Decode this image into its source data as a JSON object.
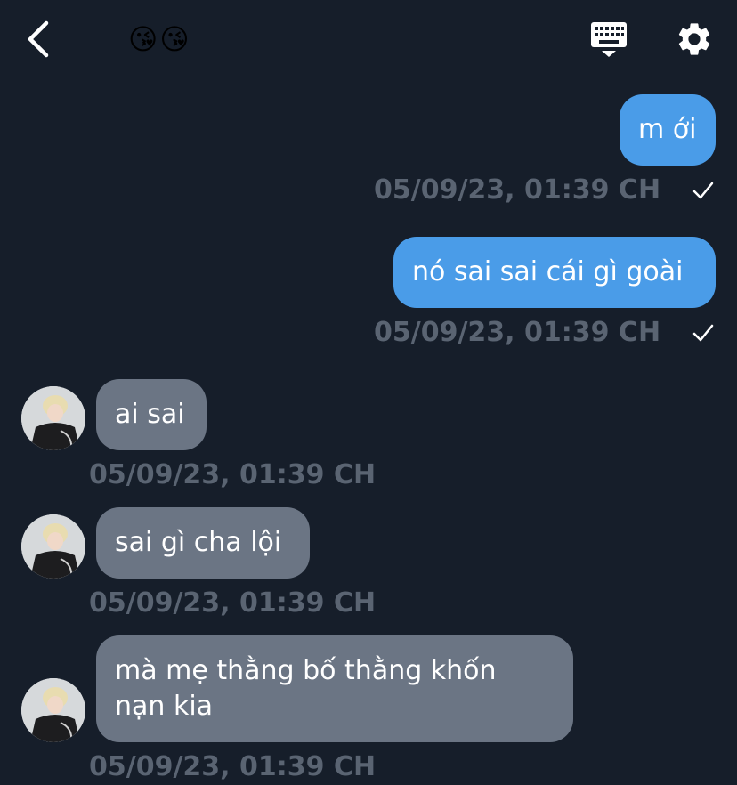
{
  "header": {
    "title": "😘😘"
  },
  "messages": [
    {
      "text": "m ới",
      "time": "05/09/23, 01:39 CH",
      "direction": "outgoing"
    },
    {
      "text": "nó sai sai cái gì goài",
      "time": "05/09/23, 01:39 CH",
      "direction": "outgoing"
    },
    {
      "text": "ai sai",
      "time": "05/09/23, 01:39 CH",
      "direction": "incoming"
    },
    {
      "text": "sai gì cha lội",
      "time": "05/09/23, 01:39 CH",
      "direction": "incoming"
    },
    {
      "text": "mà mẹ thằng bố thằng khốn\nnạn kia",
      "time": "05/09/23, 01:39 CH",
      "direction": "incoming"
    }
  ],
  "colors": {
    "background": "#161e2a",
    "outgoing_bubble": "#4a9ce8",
    "incoming_bubble": "#6b7584",
    "timestamp": "#5a6472"
  },
  "icons": {
    "back": "chevron-left-icon",
    "keyboard": "keyboard-icon",
    "settings": "gear-icon",
    "read_receipt": "checkmark-icon"
  }
}
